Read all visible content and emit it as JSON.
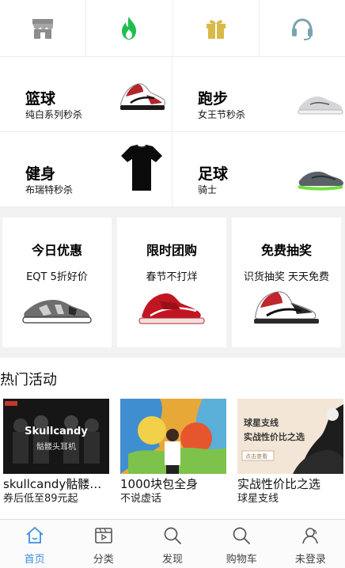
{
  "top_icons": [
    {
      "icon": "store-icon",
      "color": "#8c8c8c"
    },
    {
      "icon": "fire-icon",
      "color": "#1fbf4f"
    },
    {
      "icon": "gift-icon",
      "color": "#d9b94a"
    },
    {
      "icon": "headset-icon",
      "color": "#7aa3b0"
    }
  ],
  "categories": [
    {
      "title": "篮球",
      "subtitle": "纯白系列秒杀"
    },
    {
      "title": "跑步",
      "subtitle": "女王节秒杀"
    },
    {
      "title": "健身",
      "subtitle": "布瑞特秒杀"
    },
    {
      "title": "足球",
      "subtitle": "骑士"
    }
  ],
  "promos": [
    {
      "title": "今日优惠",
      "subtitle": "EQT 5折好价"
    },
    {
      "title": "限时团购",
      "subtitle": "春节不打烊"
    },
    {
      "title": "免费抽奖",
      "subtitle": "识货抽奖 天天免费"
    }
  ],
  "hot": {
    "title": "热门活动",
    "items": [
      {
        "title": "skullcandy骷髅头耳机",
        "subtitle": "券后低至89元起",
        "image_text": "Skullcandy",
        "image_subtext": "骷髅头耳机"
      },
      {
        "title": "1000块包全身",
        "subtitle": "不说虚话"
      },
      {
        "title": "实战性价比之选",
        "subtitle": "球星支线",
        "image_text": "球星支线",
        "image_subtext": "实战性价比之选",
        "image_button": "点击查看"
      }
    ]
  },
  "nav": [
    {
      "label": "首页",
      "icon": "home-icon",
      "active": true
    },
    {
      "label": "分类",
      "icon": "category-icon",
      "active": false
    },
    {
      "label": "发现",
      "icon": "search-icon",
      "active": false
    },
    {
      "label": "购物车",
      "icon": "cart-search-icon",
      "active": false
    },
    {
      "label": "未登录",
      "icon": "user-icon",
      "active": false
    }
  ],
  "colors": {
    "accent": "#3a8ee6",
    "band": "#f2f2f2"
  }
}
